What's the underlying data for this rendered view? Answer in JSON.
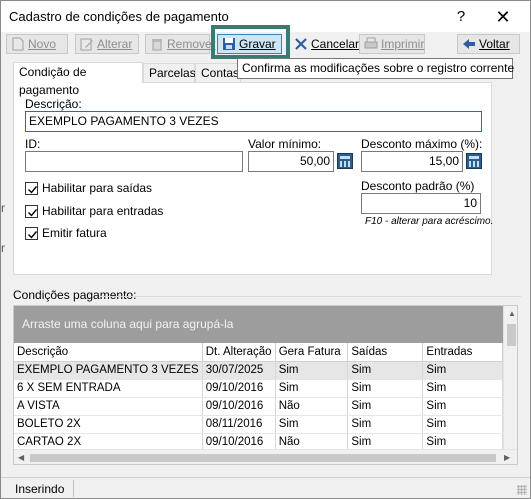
{
  "window": {
    "title": "Cadastro de condições de pagamento",
    "help": "?",
    "close": "✕"
  },
  "toolbar": {
    "novo": "Novo",
    "alterar": "Alterar",
    "remover": "Remover",
    "gravar": "Gravar",
    "cancelar": "Cancelar",
    "imprimir": "Imprimir",
    "voltar": "Voltar"
  },
  "tooltip": "Confirma as modificações sobre o registro corrente",
  "tabs": [
    "Condição de pagamento",
    "Parcelas",
    "Contas"
  ],
  "form": {
    "descricao_label": "Descrição:",
    "descricao_value": "EXEMPLO PAGAMENTO 3 VEZES",
    "id_label": "ID:",
    "id_value": "",
    "valor_minimo_label": "Valor mínimo:",
    "valor_minimo_value": "50,00",
    "desconto_maximo_label": "Desconto máximo (%):",
    "desconto_maximo_value": "15,00",
    "desconto_padrao_label": "Desconto padrão (%)",
    "desconto_padrao_value": "10",
    "hint": "F10 - alterar para acréscimo.",
    "checks": [
      {
        "label": "Habilitar para saídas",
        "checked": true
      },
      {
        "label": "Habilitar para entradas",
        "checked": true
      },
      {
        "label": "Emitir fatura",
        "checked": true
      }
    ]
  },
  "grid": {
    "group_label": "Condições pagamento:",
    "group_by_text": "Arraste uma coluna aqui para agrupá-la",
    "columns": [
      "Descrição",
      "Dt. Alteração",
      "Gera Fatura",
      "Saídas",
      "Entradas"
    ],
    "rows": [
      [
        "EXEMPLO PAGAMENTO 3 VEZES",
        "30/07/2025",
        "Sim",
        "Sim",
        "Sim"
      ],
      [
        "6 X SEM ENTRADA",
        "09/10/2016",
        "Sim",
        "Sim",
        "Sim"
      ],
      [
        "A VISTA",
        "09/10/2016",
        "Não",
        "Sim",
        "Sim"
      ],
      [
        "BOLETO 2X",
        "08/11/2016",
        "Sim",
        "Sim",
        "Sim"
      ],
      [
        "CARTAO 2X",
        "09/10/2016",
        "Não",
        "Sim",
        "Sim"
      ]
    ]
  },
  "status": {
    "text": "Inserindo"
  },
  "colors": {
    "highlight": "#3b7a72",
    "selected_row": "#e6e6e6",
    "group_area": "#9d9d9d"
  }
}
